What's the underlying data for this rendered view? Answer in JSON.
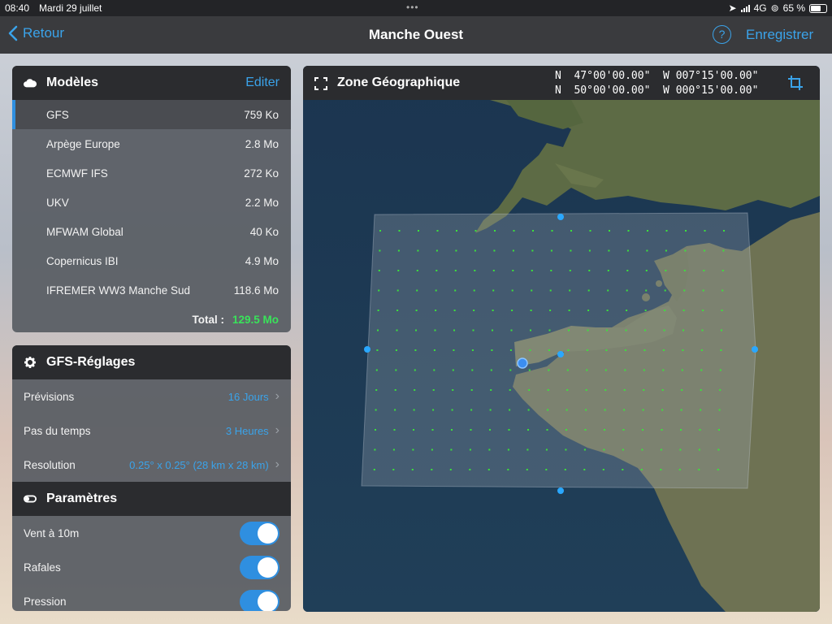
{
  "status": {
    "time": "08:40",
    "date": "Mardi 29 juillet",
    "network": "4G",
    "battery": "65 %"
  },
  "nav": {
    "back": "Retour",
    "title": "Manche Ouest",
    "save": "Enregistrer",
    "help": "?"
  },
  "models": {
    "header": "Modèles",
    "edit": "Editer",
    "items": [
      {
        "name": "GFS",
        "size": "759 Ko"
      },
      {
        "name": "Arpège Europe",
        "size": "2.8 Mo"
      },
      {
        "name": "ECMWF IFS",
        "size": "272 Ko"
      },
      {
        "name": "UKV",
        "size": "2.2 Mo"
      },
      {
        "name": "MFWAM Global",
        "size": "40 Ko"
      },
      {
        "name": "Copernicus IBI",
        "size": "4.9 Mo"
      },
      {
        "name": "IFREMER WW3 Manche Sud",
        "size": "118.6 Mo"
      }
    ],
    "total_label": "Total :",
    "total_value": "129.5 Mo"
  },
  "settings": {
    "header": "GFS-Réglages",
    "rows": [
      {
        "label": "Prévisions",
        "value": "16 Jours"
      },
      {
        "label": "Pas du temps",
        "value": "3 Heures"
      },
      {
        "label": "Resolution",
        "value": "0.25° x 0.25° (28 km x 28 km)"
      }
    ]
  },
  "params": {
    "header": "Paramètres",
    "rows": [
      {
        "label": "Vent à 10m",
        "on": true
      },
      {
        "label": "Rafales",
        "on": true
      },
      {
        "label": "Pression",
        "on": true
      }
    ]
  },
  "map": {
    "header": "Zone Géographique",
    "coord1": "N  47°00'00.00\"  W 007°15'00.00\"",
    "coord2": "N  50°00'00.00\"  W 000°15'00.00\""
  }
}
